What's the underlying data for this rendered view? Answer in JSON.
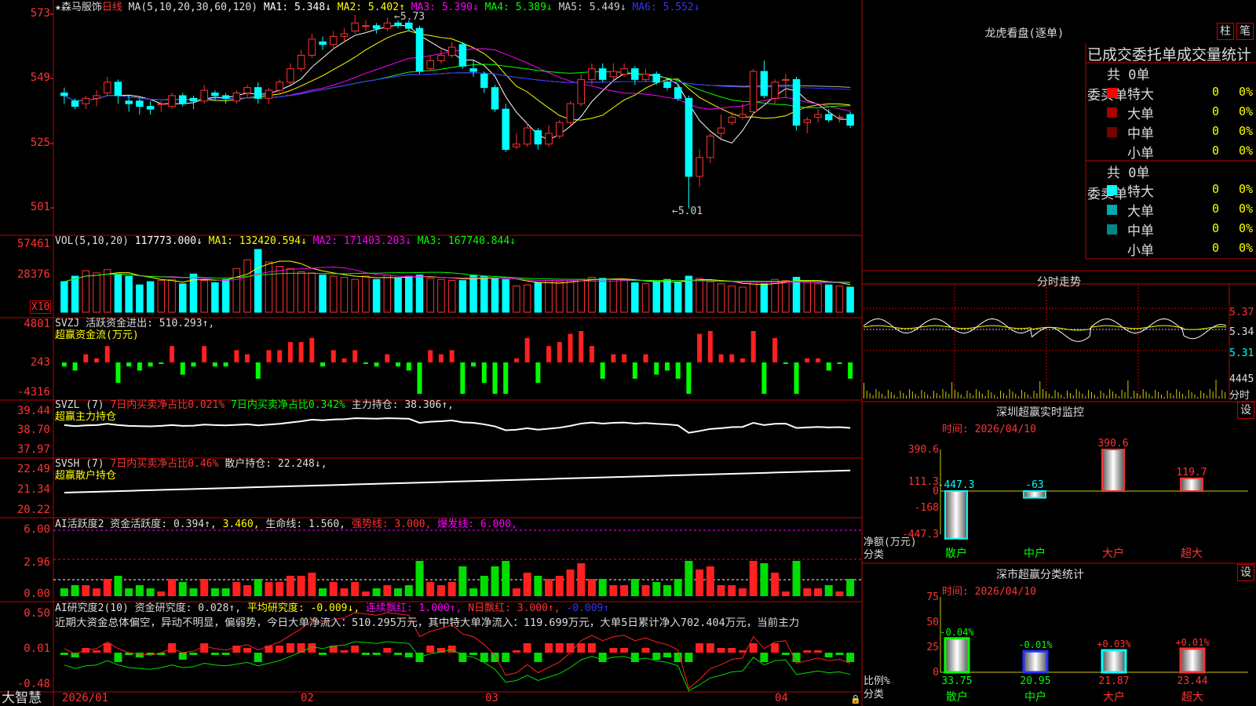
{
  "kline": {
    "star_name": "★森马服饰",
    "period": "日线",
    "ma_label": "MA(5,10,20,30,60,120)",
    "ma1": "MA1: 5.348↓",
    "ma2": "MA2: 5.402↑",
    "ma3": "MA3: 5.390↓",
    "ma4": "MA4: 5.389↓",
    "ma5": "MA5: 5.449↓",
    "ma6": "MA6: 5.552↓",
    "high_label": "←5.73",
    "low_label": "←5.01",
    "axis": [
      "573",
      "549",
      "525",
      "501"
    ]
  },
  "vol": {
    "label": "VOL(5,10,20)",
    "value": "117773.000↓",
    "ma1": "MA1: 132420.594↓",
    "ma2": "MA2: 171403.203↓",
    "ma3": "MA3: 167740.844↓",
    "axis": [
      "57461",
      "28376"
    ],
    "unit": "X10"
  },
  "svzj": {
    "label": "SVZJ  活跃资金进出: 510.293↑,",
    "sub": "超赢资金流(万元)",
    "axis": [
      "4801",
      "243",
      "-4316"
    ]
  },
  "svzl": {
    "label": "SVZL (7)",
    "a": "7日内买卖净占比0.021%",
    "b": "7日内买卖净占比0.342%",
    "c": "主力持仓: 38.306↑,",
    "sub": "超赢主力持仓",
    "axis": [
      "39.44",
      "38.70",
      "37.97"
    ]
  },
  "svsh": {
    "label": "SVSH (7)",
    "a": "7日内买卖净占比0.46%",
    "c": "散户持仓: 22.248↓,",
    "sub": "超赢散户持仓",
    "axis": [
      "22.49",
      "21.34",
      "20.22"
    ]
  },
  "ai1": {
    "label": "AI活跃度2 资金活跃度: 0.394↑,",
    "v2": "3.460,",
    "v3": "生命线: 1.560,",
    "v4": "强势线: 3.000,",
    "v5": "爆发线: 6.000,",
    "axis": [
      "6.00",
      "2.96",
      "0.00"
    ]
  },
  "ai2": {
    "label": "AI研究度2(10) 资金研究度: 0.028↑,",
    "v2": "平均研究度: -0.009↓,",
    "v3": "连续飘红: 1.000↑,",
    "v4": "N日飘红: 3.000↑,",
    "v5": "-0.009↑",
    "text": "近期大资金总体偏空，异动不明显，偏弱势，今日大单净流入：510.295万元，其中特大单净流入：119.699万元，大单5日累计净入702.404万元，当前主力",
    "axis": [
      "0.50",
      "0.01",
      "-0.48"
    ]
  },
  "xaxis": {
    "brand": "大智慧",
    "dates": [
      "2026/01",
      "02",
      "03",
      "04"
    ]
  },
  "lhb": {
    "title": "龙虎看盘(逐单)",
    "btn1": "柱",
    "btn2": "笔",
    "tabs": "已成交委托单成交量统计",
    "buy": {
      "side": "委买单",
      "total": "共 0单",
      "rows": [
        {
          "name": "特大",
          "n": "0",
          "p": "0%",
          "color": "#ff0000"
        },
        {
          "name": "大单",
          "n": "0",
          "p": "0%",
          "color": "#aa0000"
        },
        {
          "name": "中单",
          "n": "0",
          "p": "0%",
          "color": "#770000"
        },
        {
          "name": "小单",
          "n": "0",
          "p": "0%",
          "color": ""
        }
      ]
    },
    "sell": {
      "side": "委卖单",
      "total": "共 0单",
      "rows": [
        {
          "name": "特大",
          "n": "0",
          "p": "0%",
          "color": "#00ffff"
        },
        {
          "name": "大单",
          "n": "0",
          "p": "0%",
          "color": "#00aaaa"
        },
        {
          "name": "中单",
          "n": "0",
          "p": "0%",
          "color": "#008888"
        },
        {
          "name": "小单",
          "n": "0",
          "p": "0%",
          "color": ""
        }
      ]
    }
  },
  "intraday": {
    "title": "分时走势",
    "axis": [
      "5.37",
      "5.34",
      "5.31"
    ],
    "vol": "4445",
    "unit": "分时"
  },
  "monitor": {
    "title": "深圳超赢实时监控",
    "btn": "设",
    "time": "时间: 2026/04/10",
    "axis": [
      "390.6",
      "111.3",
      "0",
      "-168",
      "-447.3"
    ],
    "ylabel": "净额(万元)",
    "xlabel": "分类",
    "bars": [
      {
        "cat": "散户",
        "value": -447.3,
        "label": "-447.3"
      },
      {
        "cat": "中户",
        "value": -63,
        "label": "-63"
      },
      {
        "cat": "大户",
        "value": 390.6,
        "label": "390.6"
      },
      {
        "cat": "超大",
        "value": 119.7,
        "label": "119.7"
      }
    ]
  },
  "cls": {
    "title": "深市超赢分类统计",
    "btn": "设",
    "time": "时间: 2026/04/10",
    "axis": [
      "75",
      "50",
      "25",
      "0"
    ],
    "ylabel": "比例%",
    "xlabel": "分类",
    "bars": [
      {
        "cat": "散户",
        "value": 33.75,
        "label": "33.75",
        "chg": "-0.04%"
      },
      {
        "cat": "中户",
        "value": 20.95,
        "label": "20.95",
        "chg": "-0.01%"
      },
      {
        "cat": "大户",
        "value": 21.87,
        "label": "21.87",
        "chg": "+0.03%"
      },
      {
        "cat": "超大",
        "value": 23.44,
        "label": "23.44",
        "chg": "+0.01%"
      }
    ]
  },
  "chart_data": {
    "type": "candlestick",
    "candles": [
      [
        5.44,
        5.43,
        5.46,
        5.4
      ],
      [
        5.41,
        5.39,
        5.42,
        5.38
      ],
      [
        5.4,
        5.42,
        5.43,
        5.38
      ],
      [
        5.42,
        5.43,
        5.45,
        5.39
      ],
      [
        5.44,
        5.48,
        5.5,
        5.43
      ],
      [
        5.48,
        5.43,
        5.49,
        5.4
      ],
      [
        5.41,
        5.4,
        5.43,
        5.37
      ],
      [
        5.41,
        5.39,
        5.42,
        5.36
      ],
      [
        5.39,
        5.38,
        5.41,
        5.36
      ],
      [
        5.4,
        5.4,
        5.41,
        5.37
      ],
      [
        5.39,
        5.43,
        5.44,
        5.38
      ],
      [
        5.43,
        5.4,
        5.44,
        5.39
      ],
      [
        5.42,
        5.41,
        5.43,
        5.38
      ],
      [
        5.41,
        5.45,
        5.47,
        5.4
      ],
      [
        5.44,
        5.43,
        5.45,
        5.41
      ],
      [
        5.43,
        5.42,
        5.44,
        5.4
      ],
      [
        5.41,
        5.44,
        5.45,
        5.4
      ],
      [
        5.44,
        5.46,
        5.47,
        5.42
      ],
      [
        5.46,
        5.42,
        5.48,
        5.4
      ],
      [
        5.42,
        5.45,
        5.46,
        5.4
      ],
      [
        5.45,
        5.48,
        5.49,
        5.44
      ],
      [
        5.48,
        5.53,
        5.55,
        5.47
      ],
      [
        5.53,
        5.58,
        5.6,
        5.52
      ],
      [
        5.58,
        5.64,
        5.66,
        5.57
      ],
      [
        5.63,
        5.62,
        5.65,
        5.6
      ],
      [
        5.62,
        5.65,
        5.67,
        5.6
      ],
      [
        5.65,
        5.66,
        5.68,
        5.63
      ],
      [
        5.67,
        5.7,
        5.73,
        5.66
      ],
      [
        5.69,
        5.69,
        5.71,
        5.67
      ],
      [
        5.69,
        5.68,
        5.7,
        5.66
      ],
      [
        5.68,
        5.7,
        5.72,
        5.67
      ],
      [
        5.7,
        5.69,
        5.71,
        5.68
      ],
      [
        5.7,
        5.68,
        5.71,
        5.67
      ],
      [
        5.68,
        5.52,
        5.69,
        5.51
      ],
      [
        5.53,
        5.56,
        5.58,
        5.52
      ],
      [
        5.56,
        5.58,
        5.6,
        5.55
      ],
      [
        5.58,
        5.61,
        5.63,
        5.57
      ],
      [
        5.62,
        5.54,
        5.63,
        5.53
      ],
      [
        5.53,
        5.52,
        5.56,
        5.5
      ],
      [
        5.51,
        5.46,
        5.52,
        5.44
      ],
      [
        5.46,
        5.38,
        5.47,
        5.37
      ],
      [
        5.38,
        5.23,
        5.4,
        5.22
      ],
      [
        5.24,
        5.25,
        5.29,
        5.23
      ],
      [
        5.25,
        5.31,
        5.33,
        5.24
      ],
      [
        5.3,
        5.25,
        5.31,
        5.23
      ],
      [
        5.25,
        5.29,
        5.32,
        5.24
      ],
      [
        5.28,
        5.33,
        5.34,
        5.27
      ],
      [
        5.33,
        5.4,
        5.41,
        5.32
      ],
      [
        5.4,
        5.49,
        5.51,
        5.39
      ],
      [
        5.49,
        5.53,
        5.55,
        5.47
      ],
      [
        5.53,
        5.49,
        5.55,
        5.48
      ],
      [
        5.5,
        5.52,
        5.55,
        5.48
      ],
      [
        5.51,
        5.53,
        5.55,
        5.5
      ],
      [
        5.53,
        5.49,
        5.54,
        5.47
      ],
      [
        5.49,
        5.51,
        5.53,
        5.48
      ],
      [
        5.51,
        5.48,
        5.52,
        5.47
      ],
      [
        5.48,
        5.46,
        5.49,
        5.45
      ],
      [
        5.46,
        5.42,
        5.47,
        5.41
      ],
      [
        5.42,
        5.13,
        5.43,
        5.01
      ],
      [
        5.13,
        5.2,
        5.23,
        5.09
      ],
      [
        5.2,
        5.28,
        5.29,
        5.18
      ],
      [
        5.29,
        5.31,
        5.36,
        5.27
      ],
      [
        5.33,
        5.35,
        5.37,
        5.32
      ],
      [
        5.35,
        5.36,
        5.4,
        5.34
      ],
      [
        5.37,
        5.52,
        5.53,
        5.36
      ],
      [
        5.52,
        5.43,
        5.56,
        5.42
      ],
      [
        5.42,
        5.48,
        5.49,
        5.4
      ],
      [
        5.49,
        5.49,
        5.51,
        5.42
      ],
      [
        5.49,
        5.32,
        5.5,
        5.3
      ],
      [
        5.33,
        5.34,
        5.35,
        5.29
      ],
      [
        5.35,
        5.36,
        5.38,
        5.33
      ],
      [
        5.36,
        5.34,
        5.38,
        5.33
      ],
      [
        5.35,
        5.35,
        5.36,
        5.33
      ],
      [
        5.36,
        5.32,
        5.37,
        5.31
      ]
    ],
    "volume_x10": [
      28000,
      33000,
      38000,
      36000,
      39000,
      35000,
      33000,
      25000,
      28000,
      29000,
      30000,
      26000,
      35000,
      29000,
      27000,
      30000,
      40000,
      48000,
      57461,
      46000,
      42000,
      40000,
      37000,
      36000,
      34000,
      33000,
      32000,
      30000,
      33000,
      30000,
      34000,
      31000,
      33000,
      34000,
      31000,
      30000,
      29000,
      29000,
      34000,
      33000,
      31000,
      30000,
      24000,
      25000,
      27000,
      29000,
      28000,
      29000,
      30000,
      32000,
      31000,
      30000,
      29000,
      27000,
      26000,
      28000,
      30000,
      27000,
      33000,
      31000,
      28000,
      26000,
      24000,
      23000,
      28000,
      26000,
      30000,
      29000,
      32000,
      28000,
      26000,
      25000,
      24000,
      23000
    ],
    "ylim": [
      5.01,
      5.73
    ]
  }
}
